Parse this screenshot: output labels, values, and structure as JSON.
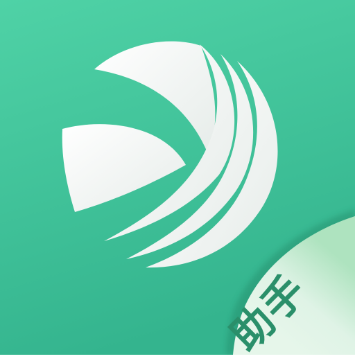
{
  "icon": {
    "name": "helper-app-icon",
    "logo": "stylized-y-globe-logo",
    "badge_text": "助手",
    "colors": {
      "background_top": "#4fd2a6",
      "background_bottom": "#34b48e",
      "logo": "#ffffff",
      "logo_shadow": "#dfe7e4",
      "curl_light": "#e6f6ea",
      "curl_mid": "#aee3bf",
      "badge_text": "#2a8f6a"
    }
  }
}
